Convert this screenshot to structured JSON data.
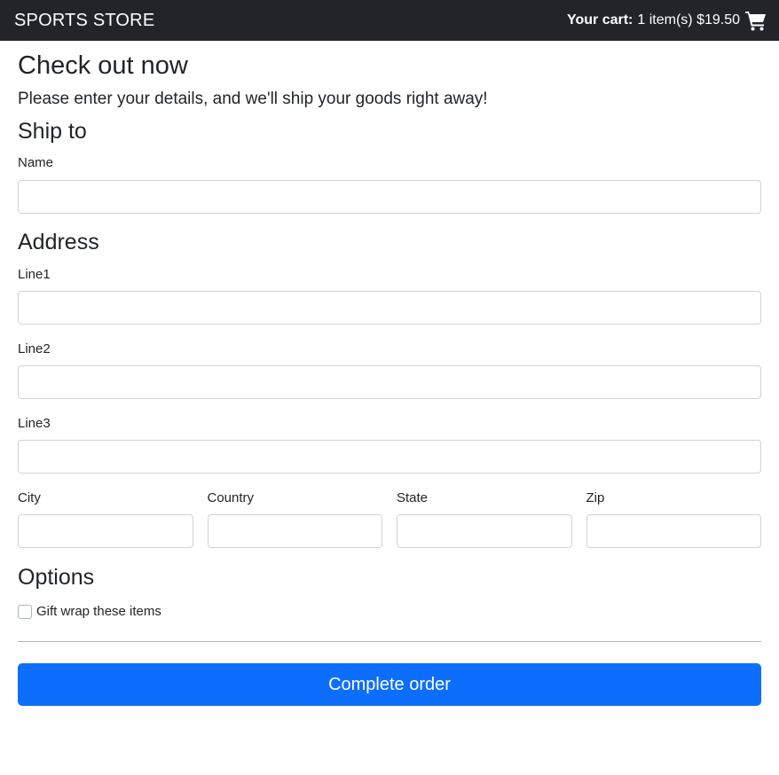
{
  "navbar": {
    "brand": "SPORTS STORE",
    "cart_label": "Your cart:",
    "cart_summary": "1 item(s) $19.50",
    "cart_icon": "shopping-cart-icon"
  },
  "page": {
    "title": "Check out now",
    "lead": "Please enter your details, and we'll ship your goods right away!"
  },
  "ship_to": {
    "heading": "Ship to",
    "name_label": "Name",
    "name_value": ""
  },
  "address": {
    "heading": "Address",
    "line1_label": "Line1",
    "line1_value": "",
    "line2_label": "Line2",
    "line2_value": "",
    "line3_label": "Line3",
    "line3_value": "",
    "city_label": "City",
    "city_value": "",
    "country_label": "Country",
    "country_value": "",
    "state_label": "State",
    "state_value": "",
    "zip_label": "Zip",
    "zip_value": ""
  },
  "options": {
    "heading": "Options",
    "giftwrap_label": "Gift wrap these items",
    "giftwrap_checked": false
  },
  "actions": {
    "submit_label": "Complete order"
  },
  "colors": {
    "navbar_bg": "#212529",
    "primary": "#0d6efd"
  }
}
